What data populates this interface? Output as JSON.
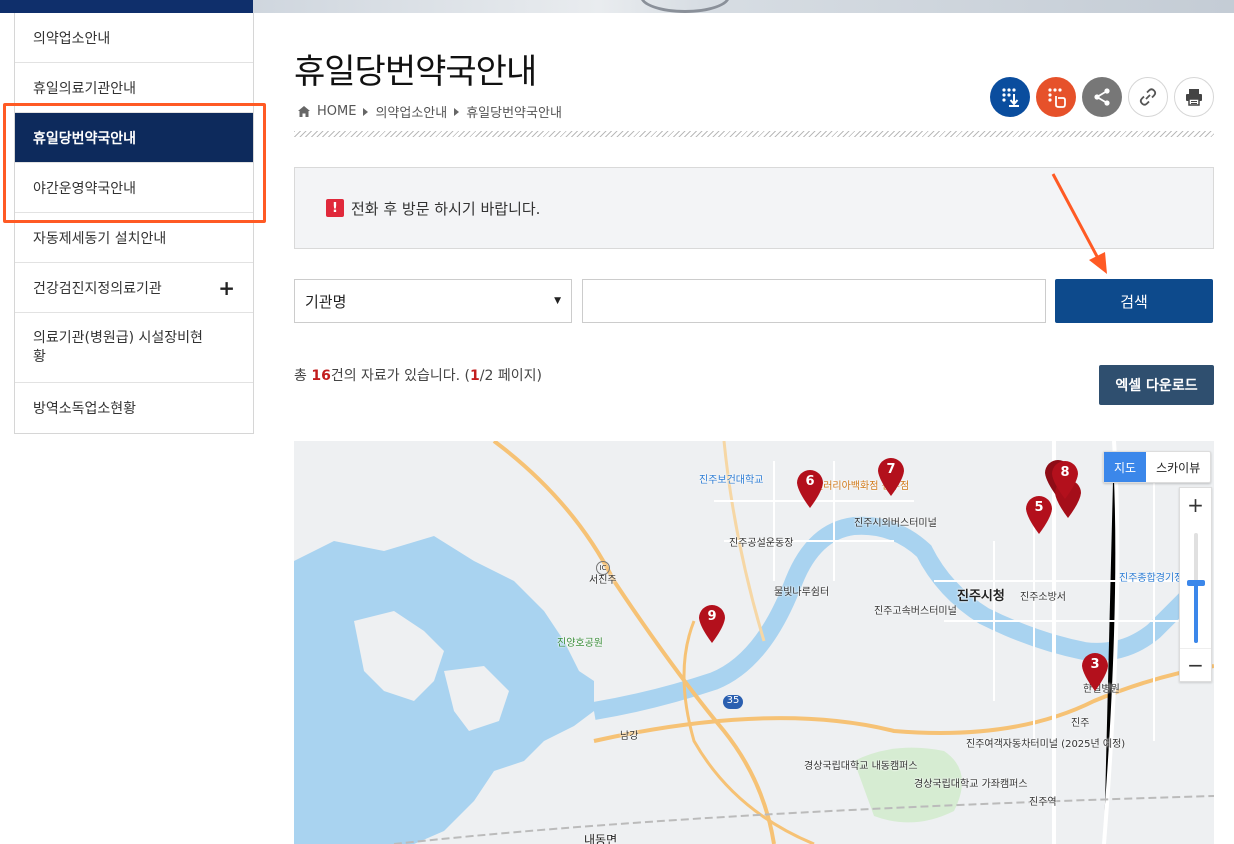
{
  "sidebar": {
    "items": [
      {
        "label": "의약업소안내"
      },
      {
        "label": "휴일의료기관안내"
      },
      {
        "label": "휴일당번약국안내"
      },
      {
        "label": "야간운영약국안내"
      },
      {
        "label": "자동제세동기 설치안내"
      },
      {
        "label": "건강검진지정의료기관",
        "expand": "+"
      },
      {
        "label": "의료기관(병원급) 시설장비현황"
      },
      {
        "label": "방역소독업소현황"
      }
    ]
  },
  "page": {
    "title": "휴일당번약국안내",
    "breadcrumb": [
      "HOME",
      "의약업소안내",
      "휴일당번약국안내"
    ]
  },
  "notice": {
    "text": "전화 후 방문 하시기 바랍니다.",
    "icon": "!"
  },
  "search": {
    "select_value": "기관명",
    "input_value": "",
    "button_label": "검색"
  },
  "results": {
    "prefix": "총 ",
    "count": "16",
    "suffix": "건의 자료가 있습니다. (",
    "page": "1",
    "page_total": "/2 페이지)"
  },
  "excel_button": "엑셀 다운로드",
  "map": {
    "type_map": "지도",
    "type_sky": "스카이뷰",
    "zoom_in": "+",
    "zoom_out": "−",
    "markers": [
      "6",
      "7",
      "8",
      "5",
      "9",
      "3"
    ],
    "labels": {
      "l1": "진주보건대학교",
      "l2": "갤러리아백화점 진주점",
      "l3": "진주시외버스터미널",
      "l4": "진주공설운동장",
      "l5": "물빛나루쉼터",
      "l6": "진주시청",
      "l7": "진주소방서",
      "l8": "진주종합경기장",
      "l9": "서진주",
      "l10": "진양호공원",
      "l11": "진주고속버스터미널",
      "l12": "한일병원",
      "l13": "진주",
      "l14": "진주여객자동차터미널 (2025년 예정)",
      "l15": "경상국립대학교 내동캠퍼스",
      "l16": "경상국립대학교 가좌캠퍼스",
      "l17": "진주역",
      "l18": "남강",
      "l19": "내동면",
      "l20": "35",
      "l21": "IC"
    }
  },
  "colors": {
    "nav_active": "#0d2a5c",
    "search_button": "#0d4a8c",
    "excel_button": "#2f4f6f",
    "highlight": "#ff5a24",
    "marker": "#b3101c"
  }
}
